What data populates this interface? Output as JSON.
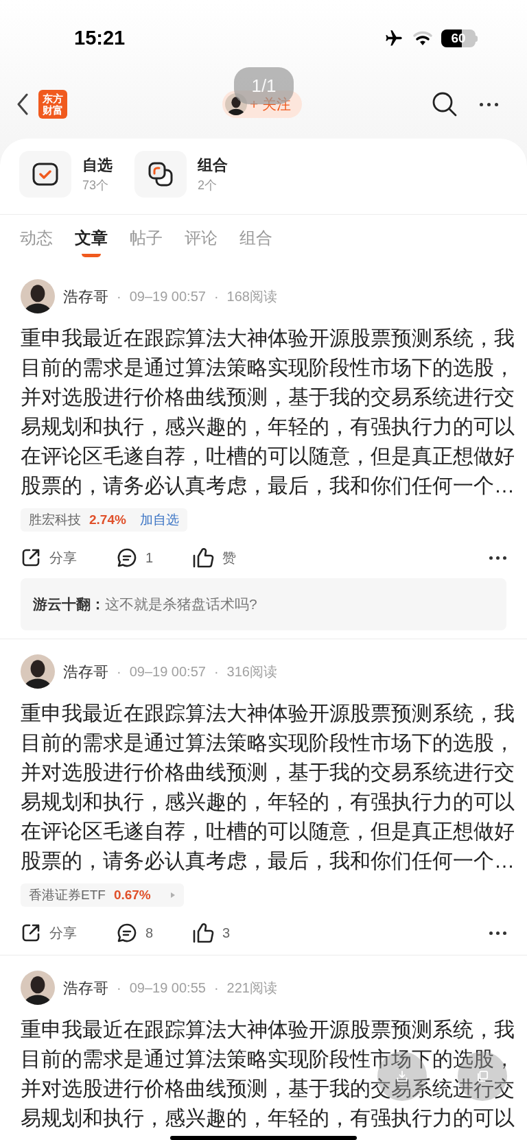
{
  "status_bar": {
    "time": "15:21",
    "battery": "60"
  },
  "nav": {
    "logo": [
      "东方",
      "财富"
    ],
    "follow_button": "+ 关注",
    "page_indicator": "1/1"
  },
  "shortcuts": [
    {
      "kind": "watchlist",
      "label": "自选",
      "count": "73个"
    },
    {
      "kind": "portfolio",
      "label": "组合",
      "count": "2个"
    }
  ],
  "tabs": [
    {
      "label": "动态",
      "selected": false
    },
    {
      "label": "文章",
      "selected": true
    },
    {
      "label": "帖子",
      "selected": false
    },
    {
      "label": "评论",
      "selected": false
    },
    {
      "label": "组合",
      "selected": false
    }
  ],
  "posts": [
    {
      "author": "浩存哥",
      "separators": [
        "·",
        "·"
      ],
      "date": "09–19 00:57",
      "reads": "168阅读",
      "text": "重申我最近在跟踪算法大神体验开源股票预测系统，我目前的需求是通过算法策略实现阶段性市场下的选股，并对选股进行价格曲线预测，基于我的交易系统进行交易规划和执行，感兴趣的，年轻的，有强执行力的可以在评论区毛遂自荐，吐槽的可以随意，但是真正想做好股票的，请务必认真考虑，最后，我和你们任何一个…",
      "stock": {
        "kind": "add",
        "name": "胜宏科技",
        "change": "2.74%",
        "action": "加自选"
      },
      "actions": {
        "share": "分享",
        "comments": "1",
        "likes": "赞"
      },
      "top_comment": {
        "author": "游云十翻：",
        "text": "这不就是杀猪盘话术吗?"
      }
    },
    {
      "author": "浩存哥",
      "separators": [
        "·",
        "·"
      ],
      "date": "09–19 00:57",
      "reads": "316阅读",
      "text": "重申我最近在跟踪算法大神体验开源股票预测系统，我目前的需求是通过算法策略实现阶段性市场下的选股，并对选股进行价格曲线预测，基于我的交易系统进行交易规划和执行，感兴趣的，年轻的，有强执行力的可以在评论区毛遂自荐，吐槽的可以随意，但是真正想做好股票的，请务必认真考虑，最后，我和你们任何一个…",
      "stock": {
        "kind": "arrow",
        "name": "香港证券ETF",
        "change": "0.67%"
      },
      "actions": {
        "share": "分享",
        "comments": "8",
        "likes": "3"
      }
    },
    {
      "author": "浩存哥",
      "separators": [
        "·",
        "·"
      ],
      "date": "09–19 00:55",
      "reads": "221阅读",
      "text": "重申我最近在跟踪算法大神体验开源股票预测系统，我目前的需求是通过算法策略实现阶段性市场下的选股，并对选股进行价格曲线预测，基于我的交易系统进行交易规划和执行，感兴趣的，年轻的，有强执行力的可以"
    }
  ]
}
